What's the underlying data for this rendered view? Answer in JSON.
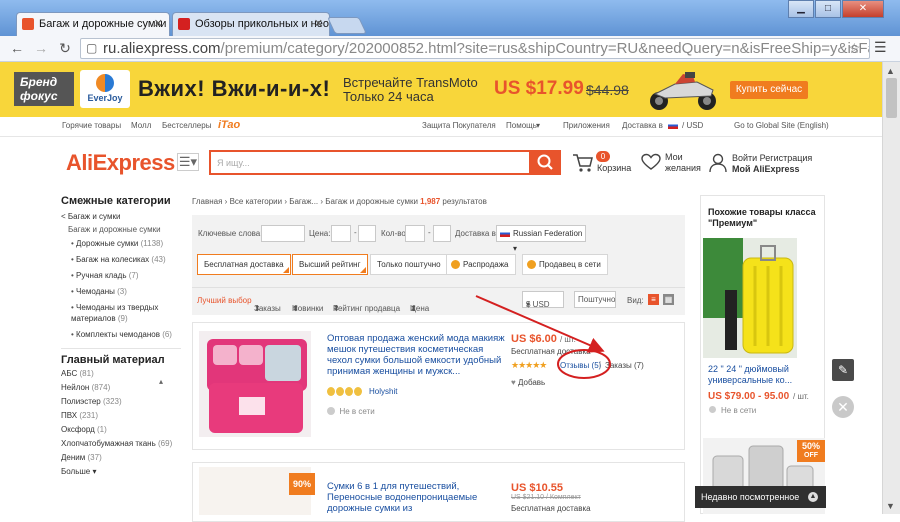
{
  "browser": {
    "tabs": [
      {
        "label": "Багаж и дорожные сумки К",
        "active": true
      },
      {
        "label": "Обзоры прикольных и необ",
        "active": false
      }
    ],
    "window_controls": {
      "minimize": "▁",
      "maximize": "□",
      "close": "✕"
    },
    "url_main": "ru.aliexpress.com",
    "url_rest": "/premium/category/202000852.html?site=rus&shipCountry=RU&needQuery=n&isFreeShip=y&isFavorite=y"
  },
  "banner": {
    "brand_line1": "Бренд",
    "brand_line2": "фокус",
    "partner": "EverJoy",
    "slogan": "Вжих! Вжи-и-и-х!",
    "promo_line1": "Встречайте TransMoto",
    "promo_line2": "Только 24 часа",
    "price": "US $17.99",
    "old_price": "$44.98",
    "cta": "Купить сейчас"
  },
  "top_links": {
    "hot": "Горячие товары",
    "mall": "Молл",
    "bestsellers": "Бестселлеры",
    "tao": "iTao",
    "buyer_protection": "Защита Покупателя",
    "help": "Помощь",
    "apps": "Приложения",
    "delivery": "Доставка в",
    "currency": "/ USD",
    "global": "Go to Global Site (English)"
  },
  "header": {
    "logo": "AliExpress",
    "search_placeholder": "Я ищу...",
    "cart_count": "0",
    "cart_label": "Корзина",
    "wish_line1": "Мои",
    "wish_line2": "желания",
    "account_top": "Войти   Регистрация",
    "account_bottom": "Мой AliExpress"
  },
  "sidebar": {
    "related_title": "Смежные категории",
    "parent": "< Багаж и сумки",
    "current": "Багаж и дорожные сумки",
    "items": [
      {
        "label": "Дорожные сумки",
        "count": "(1138)"
      },
      {
        "label": "Багаж на колесиках",
        "count": "(43)"
      },
      {
        "label": "Ручная кладь",
        "count": "(7)"
      },
      {
        "label": "Чемоданы",
        "count": "(3)"
      },
      {
        "label": "Чемоданы из твердых материалов",
        "count": "(9)"
      },
      {
        "label": "Комплекты чемоданов",
        "count": "(6)"
      }
    ],
    "material_title": "Главный материал",
    "materials": [
      {
        "label": "АБС",
        "count": "(81)"
      },
      {
        "label": "Нейлон",
        "count": "(874)"
      },
      {
        "label": "Полиэстер",
        "count": "(323)"
      },
      {
        "label": "ПВХ",
        "count": "(231)"
      },
      {
        "label": "Оксфорд",
        "count": "(1)"
      },
      {
        "label": "Хлопчатобумажная ткань",
        "count": "(69)"
      },
      {
        "label": "Деним",
        "count": "(37)"
      }
    ],
    "more": "Больше"
  },
  "breadcrumb": {
    "home": "Главная",
    "all": "Все категории",
    "baggage": "Багаж...",
    "current": "Багаж и дорожные сумки",
    "count": "1,987",
    "results": "результатов"
  },
  "filters": {
    "keywords": "Ключевые слова:",
    "price": "Цена:",
    "qty": "Кол-во:",
    "ship_to": "Доставка в",
    "country": "Russian Federation",
    "free_shipping": "Бесплатная доставка",
    "top_rated": "Высший рейтинг",
    "single": "Только поштучно",
    "sale": "Распродажа",
    "online": "Продавец в сети",
    "sort_best": "Лучший выбор",
    "sort_orders": "Заказы",
    "sort_new": "Новинки",
    "sort_rating": "Рейтинг продавца",
    "sort_price": "Цена",
    "currency": "$ USD",
    "per_unit": "Поштучно",
    "view": "Вид:"
  },
  "products": [
    {
      "title": "Оптовая продажа женский мода макияж мешок путешествия косметическая чехол сумки большой емкости удобный принимая женщины и мужск...",
      "price": "US $6.00",
      "unit": "/ шт.",
      "shipping": "Бесплатная доставка",
      "reviews": "Отзывы (5)",
      "orders": "Заказы (7)",
      "rating": 5,
      "wish": "Добавь",
      "seller": "Holyshit",
      "online": "Не в сети"
    },
    {
      "title": "Сумки 6 в 1 для путешествий, Переносные водонепроницаемые дорожные сумки из",
      "price": "US $10.55",
      "old_price": "US $21.10 / Комплект",
      "shipping": "Бесплатная доставка",
      "badge": "90%"
    }
  ],
  "right": {
    "title": "Похожие товары класса \"Премиум\"",
    "item_name": "22 \" 24 \" дюймовый универсальные ко...",
    "price": "US $79.00 - 95.00",
    "unit": "/ шт.",
    "online": "Не в сети",
    "badge_pct": "50%",
    "badge_off": "OFF",
    "recent": "Недавно посмотренное"
  },
  "colors": {
    "accent": "#e8542c",
    "banner_yellow": "#f8d63a",
    "link_blue": "#1a4fa0",
    "annotation_red": "#d42020"
  }
}
